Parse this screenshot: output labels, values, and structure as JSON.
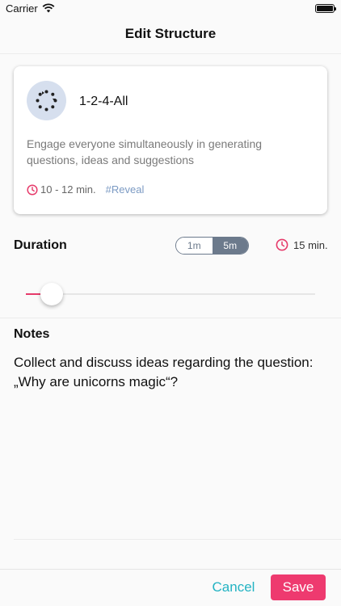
{
  "status_bar": {
    "carrier": "Carrier",
    "wifi_icon": "wifi-icon",
    "battery_icon": "battery-icon"
  },
  "nav": {
    "title": "Edit Structure"
  },
  "card": {
    "icon": "circle-of-dots-icon",
    "title": "1-2-4-All",
    "description": "Engage everyone simultaneously in generating questions, ideas and suggestions",
    "time": "10 - 12 min.",
    "tag": "#Reveal"
  },
  "duration": {
    "label": "Duration",
    "segments": [
      {
        "label": "1m",
        "selected": false
      },
      {
        "label": "5m",
        "selected": true
      }
    ],
    "total": "15 min.",
    "slider_value": 0.09
  },
  "notes": {
    "label": "Notes",
    "text": "Collect and discuss ideas regarding the question: „Why are unicorns magic“?"
  },
  "footer": {
    "cancel_label": "Cancel",
    "save_label": "Save"
  },
  "colors": {
    "accent_pink": "#ee3a6f",
    "accent_teal": "#23b3c3",
    "segment_gray": "#6c7a8c",
    "tag_blue": "#7b9ac3"
  }
}
